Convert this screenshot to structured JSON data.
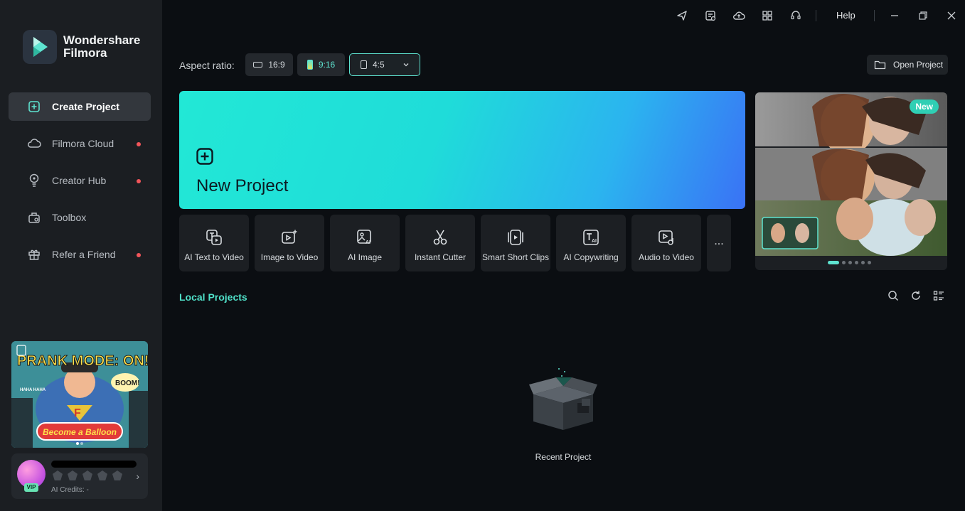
{
  "brand": {
    "line1": "Wondershare",
    "line2": "Filmora"
  },
  "sidebar": {
    "items": [
      {
        "label": "Create Project",
        "icon": "plus-square-icon",
        "active": true,
        "dot": false
      },
      {
        "label": "Filmora Cloud",
        "icon": "cloud-icon",
        "active": false,
        "dot": true
      },
      {
        "label": "Creator Hub",
        "icon": "lightbulb-icon",
        "active": false,
        "dot": true
      },
      {
        "label": "Toolbox",
        "icon": "toolbox-icon",
        "active": false,
        "dot": false
      },
      {
        "label": "Refer a Friend",
        "icon": "gift-icon",
        "active": false,
        "dot": true
      }
    ]
  },
  "promo": {
    "headline": "PRANK MODE: ON!",
    "cta": "Become a Balloon",
    "bubble1": "BOOM!",
    "bubble2": "HAHA HAHA"
  },
  "account": {
    "vip": "VIP",
    "credits": "AI Credits: -"
  },
  "titlebar": {
    "help": "Help",
    "icons": [
      "send-icon",
      "tasks-icon",
      "cloud-upload-icon",
      "grid-icon",
      "headset-icon"
    ]
  },
  "aspect": {
    "label": "Aspect ratio:",
    "options": [
      {
        "label": "16:9",
        "active": false
      },
      {
        "label": "9:16",
        "active": false
      },
      {
        "label": "4:5",
        "active": true
      }
    ]
  },
  "open_project": "Open Project",
  "hero": {
    "title": "New Project"
  },
  "tools": [
    {
      "label": "AI Text to Video",
      "icon": "text-to-video-icon"
    },
    {
      "label": "Image to Video",
      "icon": "image-to-video-icon"
    },
    {
      "label": "AI Image",
      "icon": "ai-image-icon"
    },
    {
      "label": "Instant Cutter",
      "icon": "scissors-icon"
    },
    {
      "label": "Smart Short Clips",
      "icon": "short-clips-icon"
    },
    {
      "label": "AI Copywriting",
      "icon": "ai-copywriting-icon"
    },
    {
      "label": "Audio to Video",
      "icon": "audio-to-video-icon"
    }
  ],
  "tools_more": "...",
  "banner": {
    "badge": "New",
    "slides": 6,
    "current": 1
  },
  "local": {
    "title": "Local Projects",
    "empty": "Recent Project"
  },
  "colors": {
    "accent": "#5ee3d0",
    "sidebar_bg": "#1b1e22",
    "main_bg": "#0b0e12",
    "dot": "#f2555a"
  }
}
